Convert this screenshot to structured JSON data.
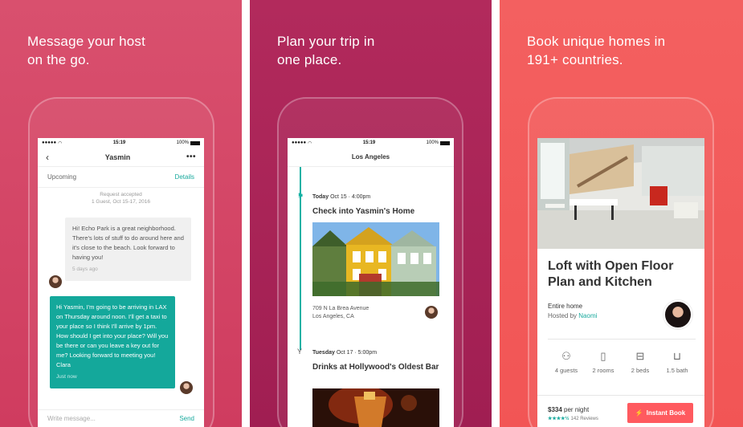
{
  "panels": [
    {
      "headline": "Message your host\non the go.",
      "status": {
        "time": "15:19",
        "battery": "100%"
      },
      "chat": {
        "title": "Yasmin",
        "upcoming": "Upcoming",
        "details": "Details",
        "request": "Request accepted",
        "guest_dates": "1 Guest, Oct 15-17, 2016",
        "incoming": "Hi! Echo Park is a great neighborhood. There's lots of stuff to do around here and it's close to the beach. Look forward to having you!",
        "incoming_time": "5 days ago",
        "outgoing": "Hi Yasmin, I'm going to be arriving in LAX on Thursday around noon. I'll get a taxi to your place so I think I'll arrive by 1pm. How should I get into your place? Will you be there or can you leave a key out for me? Looking forward to meeting you! Clara",
        "outgoing_time": "Just now",
        "compose_placeholder": "Write message...",
        "send": "Send"
      }
    },
    {
      "headline": "Plan your trip in\none place.",
      "status": {
        "time": "15:19",
        "battery": "100%"
      },
      "trip": {
        "city": "Los Angeles",
        "event1": {
          "day": "Today",
          "date": "Oct 15 · 4:00pm",
          "title": "Check into Yasmin's Home",
          "addr1": "709 N La Brea Avenue",
          "addr2": "Los Angeles, CA"
        },
        "event2": {
          "day": "Tuesday",
          "date": "Oct 17 · 5:00pm",
          "title": "Drinks at Hollywood's Oldest Bar"
        }
      }
    },
    {
      "headline": "Book unique homes in\n191+ countries.",
      "home": {
        "title": "Loft with Open Floor Plan and Kitchen",
        "type": "Entire home",
        "hosted_prefix": "Hosted by",
        "host": "Naomi",
        "amenities": [
          {
            "icon": "guests-icon",
            "label": "4 guests"
          },
          {
            "icon": "door-icon",
            "label": "2 rooms"
          },
          {
            "icon": "bed-icon",
            "label": "2 beds"
          },
          {
            "icon": "bath-icon",
            "label": "1.5 bath"
          }
        ],
        "price": "$334",
        "per_night": "per night",
        "stars": "★★★★½",
        "reviews": "142 Reviews",
        "book": "Instant Book"
      }
    }
  ],
  "colors": {
    "panel1": "#d44567",
    "panel2": "#a82357",
    "panel3": "#f35a5a",
    "teal": "#18a99d",
    "book": "#ff5a5f"
  }
}
